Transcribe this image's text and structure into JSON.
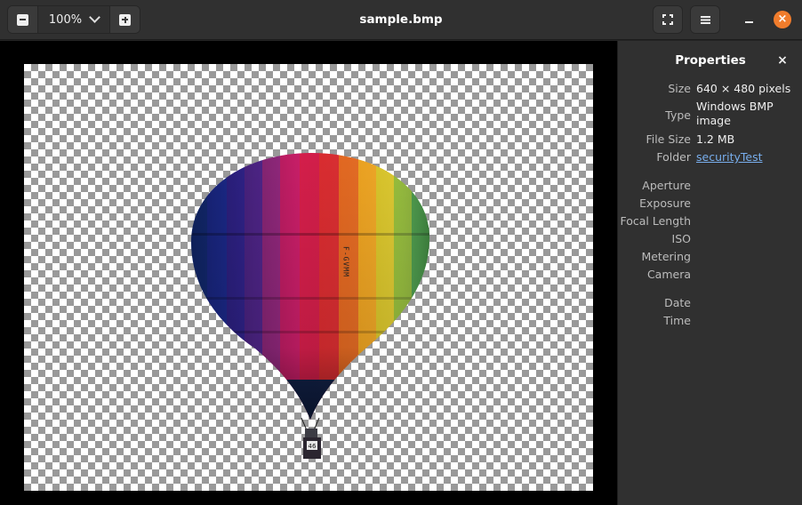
{
  "window": {
    "title": "sample.bmp"
  },
  "toolbar": {
    "zoom_level": "100%"
  },
  "icons": {
    "zoom_out": "zoom-out-icon",
    "zoom_in": "zoom-in-icon",
    "zoom_menu": "chevron-down-icon",
    "fullscreen": "fullscreen-icon",
    "menu": "hamburger-menu-icon",
    "minimize": "minimize-icon",
    "close": "close-icon"
  },
  "colors": {
    "close_button": "#f07c2c",
    "link": "#78aeed",
    "sidebar_bg": "#303030",
    "viewer_bg": "#000000"
  },
  "sidebar": {
    "title": "Properties",
    "close_symbol": "×",
    "properties": [
      {
        "key": "Size",
        "value": "640 × 480 pixels"
      },
      {
        "key": "Type",
        "value": "Windows BMP image"
      },
      {
        "key": "File Size",
        "value": "1.2 MB"
      },
      {
        "key": "Folder",
        "value": "securityTest",
        "link": true
      },
      {
        "key": "Aperture",
        "value": ""
      },
      {
        "key": "Exposure",
        "value": ""
      },
      {
        "key": "Focal Length",
        "value": ""
      },
      {
        "key": "ISO",
        "value": ""
      },
      {
        "key": "Metering",
        "value": ""
      },
      {
        "key": "Camera",
        "value": ""
      },
      {
        "key": "Date",
        "value": ""
      },
      {
        "key": "Time",
        "value": ""
      }
    ]
  },
  "image": {
    "subject": "hot-air balloon",
    "balloon_text": "F-GVMM",
    "basket_number": "46"
  }
}
